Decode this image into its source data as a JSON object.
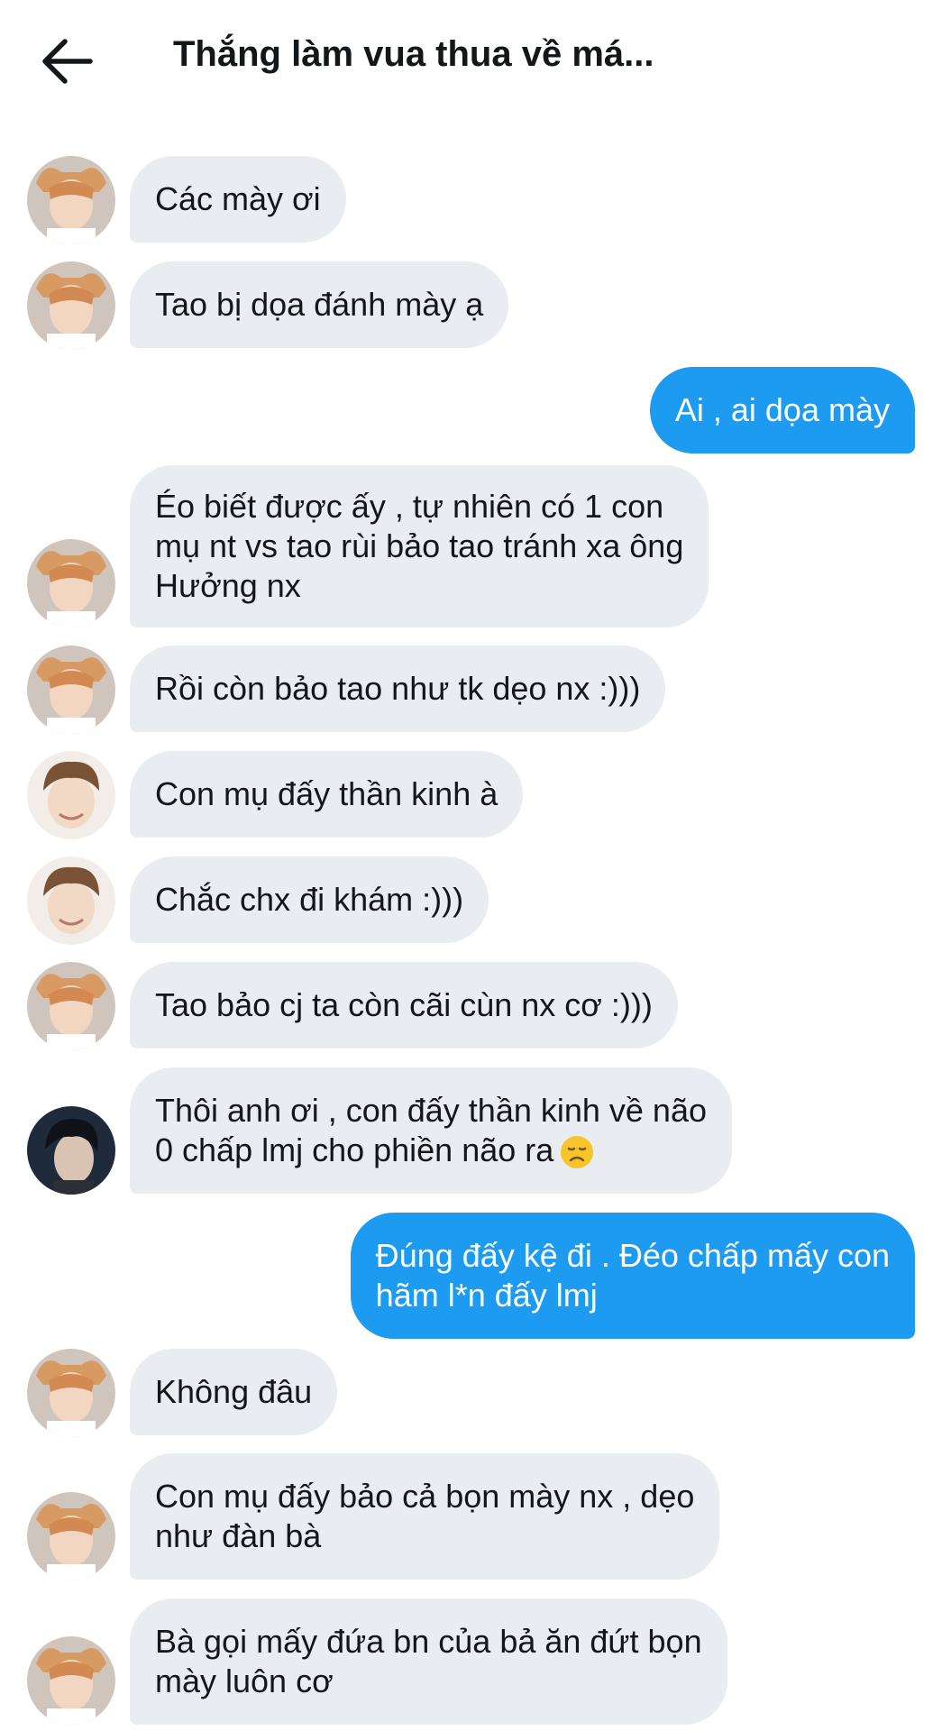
{
  "header": {
    "back_icon": "arrow-left-icon",
    "title": "Thắng làm vua thua về má..."
  },
  "colors": {
    "incoming_bubble": "#e9ecf0",
    "outgoing_bubble": "#1d9bf0",
    "outgoing_text": "#ffffff",
    "incoming_text": "#14171a"
  },
  "messages": [
    {
      "direction": "in",
      "avatar": "avatar-orange-hair",
      "text": "Các mày ơi"
    },
    {
      "direction": "in",
      "avatar": "avatar-orange-hair",
      "text": "Tao bị dọa đánh mày ạ"
    },
    {
      "direction": "out",
      "text": "Ai , ai dọa mày"
    },
    {
      "direction": "in",
      "avatar": "avatar-orange-hair",
      "text": "Éo biết được ấy , tự nhiên có 1 con\nmụ nt vs tao rùi bảo tao tránh xa ông\nHưởng nx"
    },
    {
      "direction": "in",
      "avatar": "avatar-orange-hair",
      "text": "Rồi còn bảo tao như tk dẹo nx :)))"
    },
    {
      "direction": "in",
      "avatar": "avatar-brown-hair",
      "text": "Con mụ đấy thần kinh à"
    },
    {
      "direction": "in",
      "avatar": "avatar-brown-hair",
      "text": "Chắc chx đi khám :)))"
    },
    {
      "direction": "in",
      "avatar": "avatar-orange-hair",
      "text": "Tao bảo cj ta còn cãi cùn nx cơ :)))"
    },
    {
      "direction": "in",
      "avatar": "avatar-dark-hair",
      "text": "Thôi anh ơi , con đấy thần kinh về não\n0 chấp lmj cho phiền não ra",
      "emoji": "disappointed-face-emoji"
    },
    {
      "direction": "out",
      "text": "Đúng đấy kệ đi . Đéo chấp mấy con\nhãm l*n đấy lmj"
    },
    {
      "direction": "in",
      "avatar": "avatar-orange-hair",
      "text": "Không đâu"
    },
    {
      "direction": "in",
      "avatar": "avatar-orange-hair",
      "text": "Con mụ đấy bảo cả bọn mày nx , dẹo\nnhư đàn bà"
    },
    {
      "direction": "in",
      "avatar": "avatar-orange-hair",
      "text": "Bà gọi mấy đứa bn của bả ăn đứt bọn\nmày luôn cơ"
    }
  ]
}
